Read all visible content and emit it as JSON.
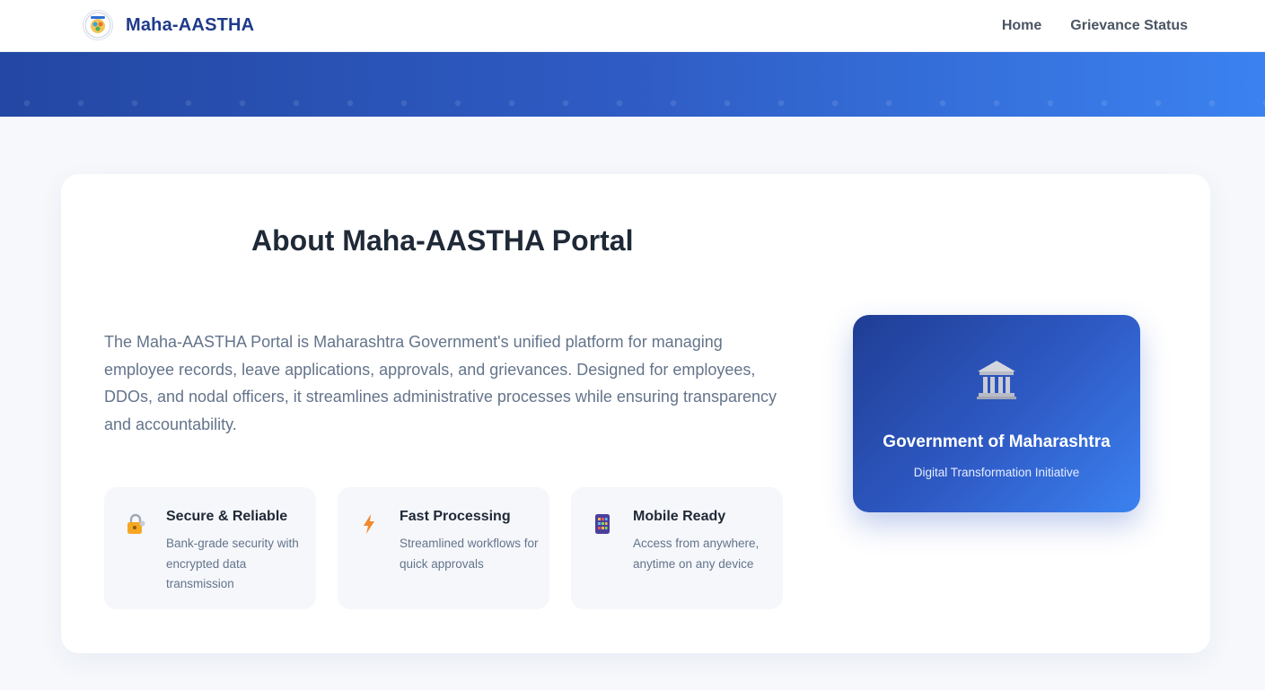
{
  "nav": {
    "brand": "Maha-AASTHA",
    "links": [
      {
        "label": "Home"
      },
      {
        "label": "Grievance Status"
      }
    ]
  },
  "about": {
    "title": "About Maha-AASTHA Portal",
    "description": "The Maha-AASTHA Portal is Maharashtra Government's unified platform for managing employee records, leave applications, approvals, and grievances. Designed for employees, DDOs, and nodal officers, it streamlines administrative processes while ensuring transparency and accountability.",
    "features": [
      {
        "icon": "lock-icon",
        "title": "Secure & Reliable",
        "description": "Bank-grade security with encrypted data transmission"
      },
      {
        "icon": "lightning-icon",
        "title": "Fast Processing",
        "description": "Streamlined workflows for quick approvals"
      },
      {
        "icon": "mobile-icon",
        "title": "Mobile Ready",
        "description": "Access from anywhere, anytime on any device"
      }
    ]
  },
  "gov_card": {
    "icon": "government-building-icon",
    "title": "Government of Maharashtra",
    "subtitle": "Digital Transformation Initiative"
  },
  "colors": {
    "brand": "#1e3a8a",
    "hero_start": "#2347a3",
    "hero_end": "#3b82f0",
    "background": "#f6f8fb"
  }
}
